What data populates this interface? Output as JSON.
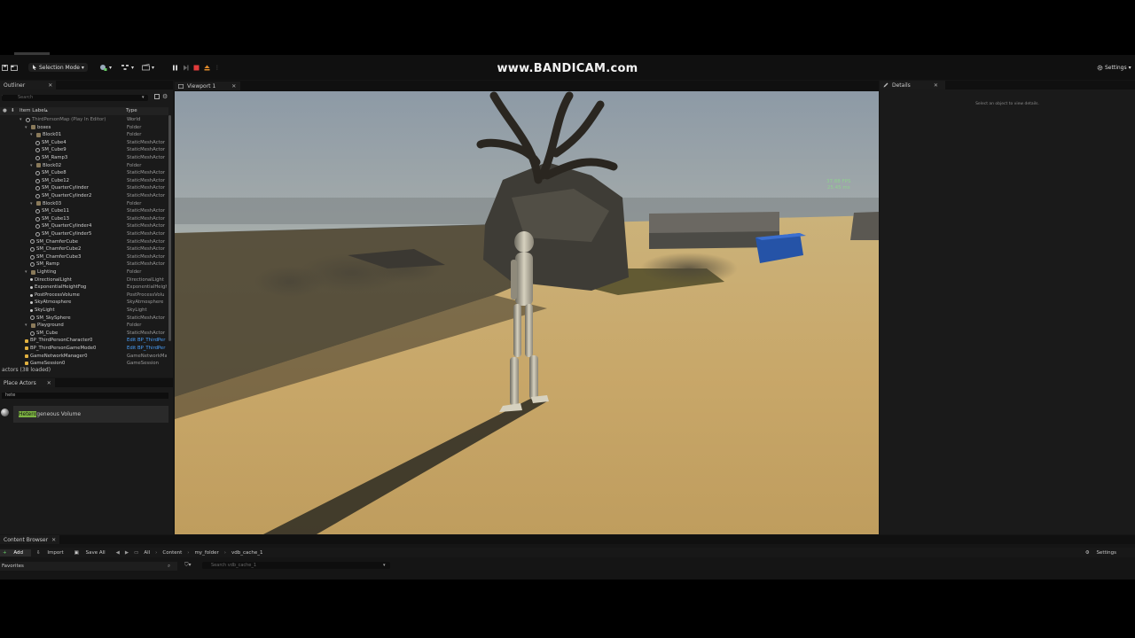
{
  "watermark": "www.BANDICAM.com",
  "toolbar": {
    "selection_mode": "Selection Mode",
    "settings": "Settings"
  },
  "outliner": {
    "tab": "Outliner",
    "search_placeholder": "Search",
    "col_label": "Item Label",
    "col_type": "Type",
    "rows": [
      {
        "label": "ThirdPersonMap (Play In Editor)",
        "type": "World",
        "indent": 0,
        "icon": "world",
        "dim": true
      },
      {
        "label": "boxes",
        "type": "Folder",
        "indent": 1,
        "icon": "folder"
      },
      {
        "label": "Block01",
        "type": "Folder",
        "indent": 2,
        "icon": "folder"
      },
      {
        "label": "SM_Cube4",
        "type": "StaticMeshActor",
        "indent": 3,
        "icon": "mesh"
      },
      {
        "label": "SM_Cube9",
        "type": "StaticMeshActor",
        "indent": 3,
        "icon": "mesh"
      },
      {
        "label": "SM_Ramp3",
        "type": "StaticMeshActor",
        "indent": 3,
        "icon": "mesh"
      },
      {
        "label": "Block02",
        "type": "Folder",
        "indent": 2,
        "icon": "folder"
      },
      {
        "label": "SM_Cube8",
        "type": "StaticMeshActor",
        "indent": 3,
        "icon": "mesh"
      },
      {
        "label": "SM_Cube12",
        "type": "StaticMeshActor",
        "indent": 3,
        "icon": "mesh"
      },
      {
        "label": "SM_QuarterCylinder",
        "type": "StaticMeshActor",
        "indent": 3,
        "icon": "mesh"
      },
      {
        "label": "SM_QuarterCylinder2",
        "type": "StaticMeshActor",
        "indent": 3,
        "icon": "mesh"
      },
      {
        "label": "Block03",
        "type": "Folder",
        "indent": 2,
        "icon": "folder"
      },
      {
        "label": "SM_Cube11",
        "type": "StaticMeshActor",
        "indent": 3,
        "icon": "mesh"
      },
      {
        "label": "SM_Cube13",
        "type": "StaticMeshActor",
        "indent": 3,
        "icon": "mesh"
      },
      {
        "label": "SM_QuarterCylinder4",
        "type": "StaticMeshActor",
        "indent": 3,
        "icon": "mesh"
      },
      {
        "label": "SM_QuarterCylinder5",
        "type": "StaticMeshActor",
        "indent": 3,
        "icon": "mesh"
      },
      {
        "label": "SM_ChamferCube",
        "type": "StaticMeshActor",
        "indent": 2,
        "icon": "mesh"
      },
      {
        "label": "SM_ChamferCube2",
        "type": "StaticMeshActor",
        "indent": 2,
        "icon": "mesh"
      },
      {
        "label": "SM_ChamferCube3",
        "type": "StaticMeshActor",
        "indent": 2,
        "icon": "mesh"
      },
      {
        "label": "SM_Ramp",
        "type": "StaticMeshActor",
        "indent": 2,
        "icon": "mesh"
      },
      {
        "label": "Lighting",
        "type": "Folder",
        "indent": 1,
        "icon": "folder"
      },
      {
        "label": "DirectionalLight",
        "type": "DirectionalLight",
        "indent": 2,
        "icon": "light"
      },
      {
        "label": "ExponentialHeightFog",
        "type": "ExponentialHeightF",
        "indent": 2,
        "icon": "light"
      },
      {
        "label": "PostProcessVolume",
        "type": "PostProcessVolu",
        "indent": 2,
        "icon": "light"
      },
      {
        "label": "SkyAtmosphere",
        "type": "SkyAtmosphere",
        "indent": 2,
        "icon": "light"
      },
      {
        "label": "SkyLight",
        "type": "SkyLight",
        "indent": 2,
        "icon": "light"
      },
      {
        "label": "SM_SkySphere",
        "type": "StaticMeshActor",
        "indent": 2,
        "icon": "mesh"
      },
      {
        "label": "Playground",
        "type": "Folder",
        "indent": 1,
        "icon": "folder"
      },
      {
        "label": "SM_Cube",
        "type": "StaticMeshActor",
        "indent": 2,
        "icon": "mesh"
      },
      {
        "label": "BP_ThirdPersonCharacter0",
        "type": "Edit BP_ThirdPer",
        "indent": 1,
        "icon": "actor",
        "link": true
      },
      {
        "label": "BP_ThirdPersonGameMode0",
        "type": "Edit BP_ThirdPer",
        "indent": 1,
        "icon": "actor",
        "link": true
      },
      {
        "label": "GameNetworkManager0",
        "type": "GameNetworkMa",
        "indent": 1,
        "icon": "actor"
      },
      {
        "label": "GameSession0",
        "type": "GameSession",
        "indent": 1,
        "icon": "actor"
      }
    ],
    "status": "actors (38 loaded)"
  },
  "place_actors": {
    "tab": "Place Actors",
    "search_value": "hete",
    "item_highlight": "Hetero",
    "item_rest": "geneous Volume"
  },
  "viewport": {
    "tab": "Viewport 1",
    "fps": "37.88 FPS",
    "ms": "25.45 ms"
  },
  "details": {
    "tab": "Details",
    "hint": "Select an object to view details."
  },
  "content_browser": {
    "tab": "Content Browser",
    "add": "Add",
    "import": "Import",
    "save_all": "Save All",
    "crumbs": [
      "All",
      "Content",
      "my_folder",
      "vdb_cache_1"
    ],
    "settings": "Settings",
    "favorites": "Favorites",
    "search_placeholder": "Search vdb_cache_1"
  }
}
